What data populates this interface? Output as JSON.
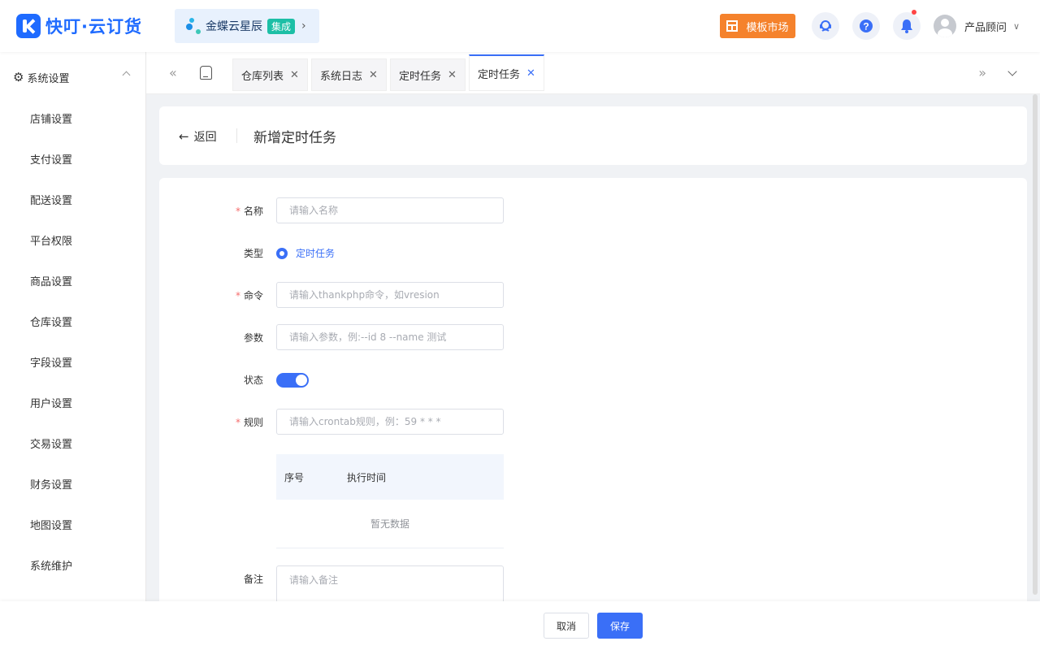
{
  "brand": {
    "name": "快叮·云订货",
    "color": "#1f6bff"
  },
  "header": {
    "integration": {
      "label": "金蝶云星辰",
      "badge": "集成"
    },
    "market_label": "模板市场",
    "user_name": "产品顾问",
    "icons": [
      "customer-service-icon",
      "help-icon",
      "bell-icon"
    ]
  },
  "sidebar": {
    "group_title": "系统设置",
    "items": [
      "店铺设置",
      "支付设置",
      "配送设置",
      "平台权限",
      "商品设置",
      "仓库设置",
      "字段设置",
      "用户设置",
      "交易设置",
      "财务设置",
      "地图设置",
      "系统维护"
    ]
  },
  "tabs": [
    {
      "label": "仓库列表",
      "active": false
    },
    {
      "label": "系统日志",
      "active": false
    },
    {
      "label": "定时任务",
      "active": false
    },
    {
      "label": "定时任务",
      "active": true
    }
  ],
  "page": {
    "back_label": "返回",
    "title": "新增定时任务"
  },
  "form": {
    "name": {
      "label": "名称",
      "placeholder": "请输入名称",
      "required": true
    },
    "type": {
      "label": "类型",
      "option": "定时任务"
    },
    "command": {
      "label": "命令",
      "placeholder": "请输入thankphp命令，如vresion",
      "required": true
    },
    "params": {
      "label": "参数",
      "placeholder": "请输入参数，例:--id 8 --name 测试"
    },
    "status": {
      "label": "状态",
      "on": true
    },
    "rule": {
      "label": "规则",
      "placeholder": "请输入crontab规则，例：59 * * *",
      "required": true
    },
    "table": {
      "col_index": "序号",
      "col_time": "执行时间",
      "empty": "暂无数据"
    },
    "remark": {
      "label": "备注",
      "placeholder": "请输入备注"
    }
  },
  "footer": {
    "cancel_label": "取消",
    "save_label": "保存"
  },
  "colors": {
    "primary": "#3a6ff7",
    "accent_orange": "#f5822c",
    "required": "#f56c6c"
  }
}
